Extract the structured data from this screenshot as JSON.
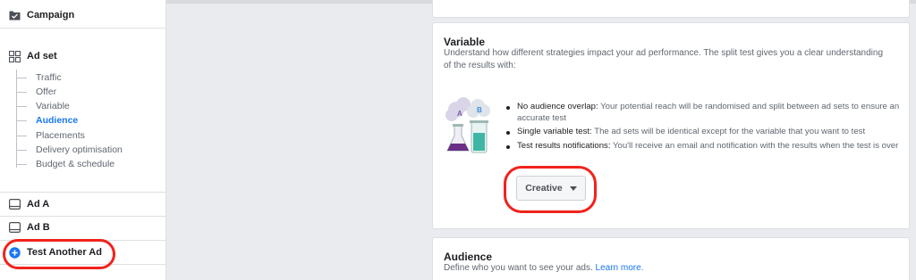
{
  "sidebar": {
    "campaign_label": "Campaign",
    "adset_label": "Ad set",
    "adset_items": [
      {
        "label": "Traffic"
      },
      {
        "label": "Offer"
      },
      {
        "label": "Variable"
      },
      {
        "label": "Audience"
      },
      {
        "label": "Placements"
      },
      {
        "label": "Delivery optimisation"
      },
      {
        "label": "Budget & schedule"
      }
    ],
    "active_item": "Audience",
    "ad_a_label": "Ad A",
    "ad_b_label": "Ad B",
    "test_another_ad_label": "Test Another Ad"
  },
  "variable_section": {
    "title": "Variable",
    "description": "Understand how different strategies impact your ad performance. The split test gives you a clear understanding of the results with:",
    "bullets": [
      {
        "title": "No audience overlap:",
        "text": " Your potential reach will be randomised and split between ad sets to ensure an accurate test"
      },
      {
        "title": "Single variable test:",
        "text": " The ad sets will be identical except for the variable that you want to test"
      },
      {
        "title": "Test results notifications:",
        "text": " You'll receive an email and notification with the results when the test is over"
      }
    ],
    "illustration_letters": {
      "a": "A",
      "b": "B"
    },
    "dropdown_value": "Creative"
  },
  "audience_section": {
    "title": "Audience",
    "description": "Define who you want to see your ads.",
    "learn_more": "Learn more."
  },
  "colors": {
    "accent": "#1877f2",
    "highlight": "#f0231c",
    "background": "#e9ebee"
  }
}
